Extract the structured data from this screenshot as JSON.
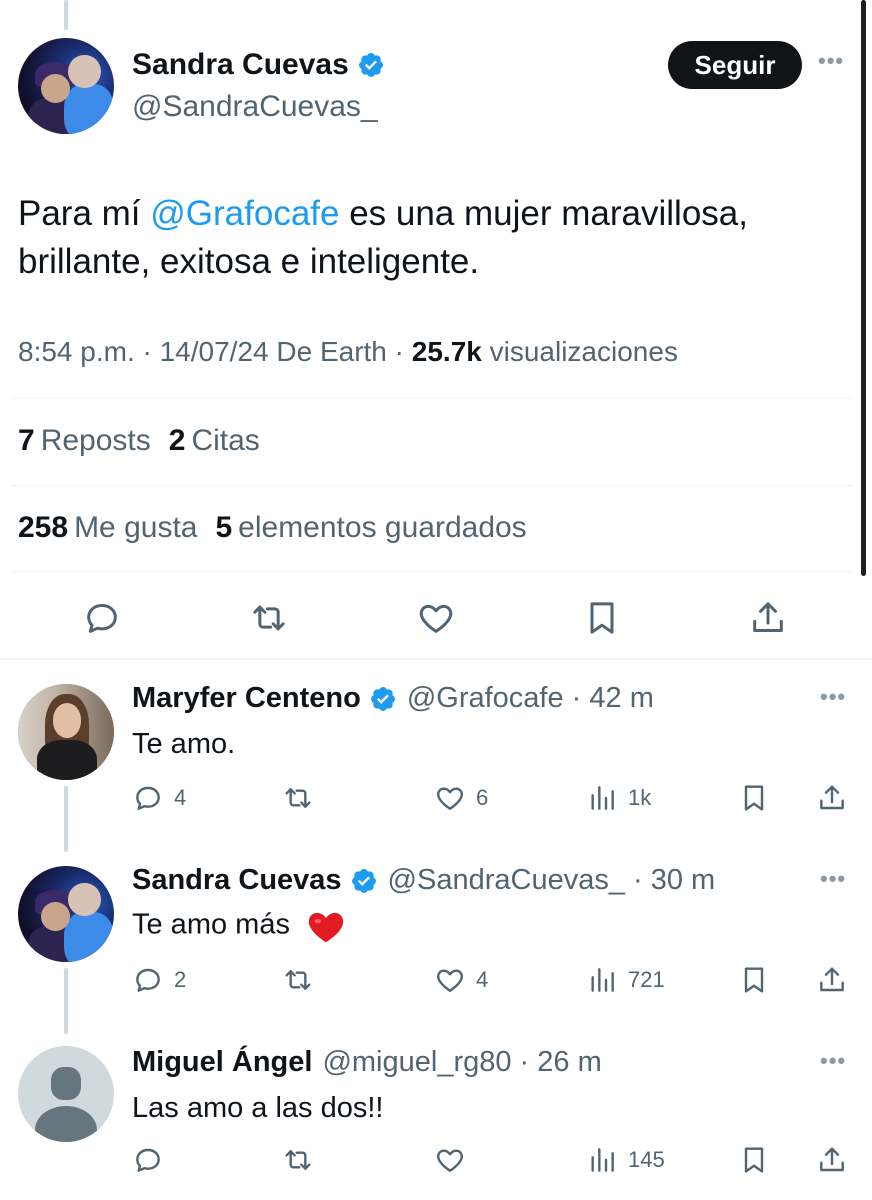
{
  "main_tweet": {
    "author_name": "Sandra Cuevas",
    "author_handle": "@SandraCuevas_",
    "follow_label": "Seguir",
    "more_label": "•••",
    "text_prefix": "Para mí ",
    "mention": "@Grafocafe",
    "text_line1_rest": " es una mujer maravillosa,",
    "text_line2": "brillante, exitosa e inteligente.",
    "timestamp": "8:54 p.m. · 14/07/24 De Earth · ",
    "views_count": "25.7k",
    "views_label": " visualizaciones",
    "reposts_count": "7",
    "reposts_label": "Reposts",
    "quotes_count": "2",
    "quotes_label": "Citas",
    "likes_count": "258",
    "likes_label": "Me gusta",
    "bookmarks_count": "5",
    "bookmarks_label": "elementos guardados"
  },
  "replies": [
    {
      "name": "Maryfer Centeno",
      "verified": true,
      "handle_time": "@Grafocafe · 42 m",
      "text": "Te amo.",
      "reply_count": "4",
      "repost_count": "",
      "like_count": "6",
      "view_count": "1k"
    },
    {
      "name": "Sandra Cuevas",
      "verified": true,
      "handle_time": "@SandraCuevas_ · 30 m",
      "text": "Te amo más",
      "reply_count": "2",
      "repost_count": "",
      "like_count": "4",
      "view_count": "721"
    },
    {
      "name": "Miguel Ángel",
      "verified": false,
      "handle_time": "@miguel_rg80 · 26 m",
      "text": "Las amo a las dos!!",
      "reply_count": "",
      "repost_count": "",
      "like_count": "",
      "view_count": "145"
    }
  ],
  "colors": {
    "accent": "#1d9bf0",
    "text": "#0f1419",
    "secondary": "#536471",
    "divider": "#eff3f4"
  }
}
